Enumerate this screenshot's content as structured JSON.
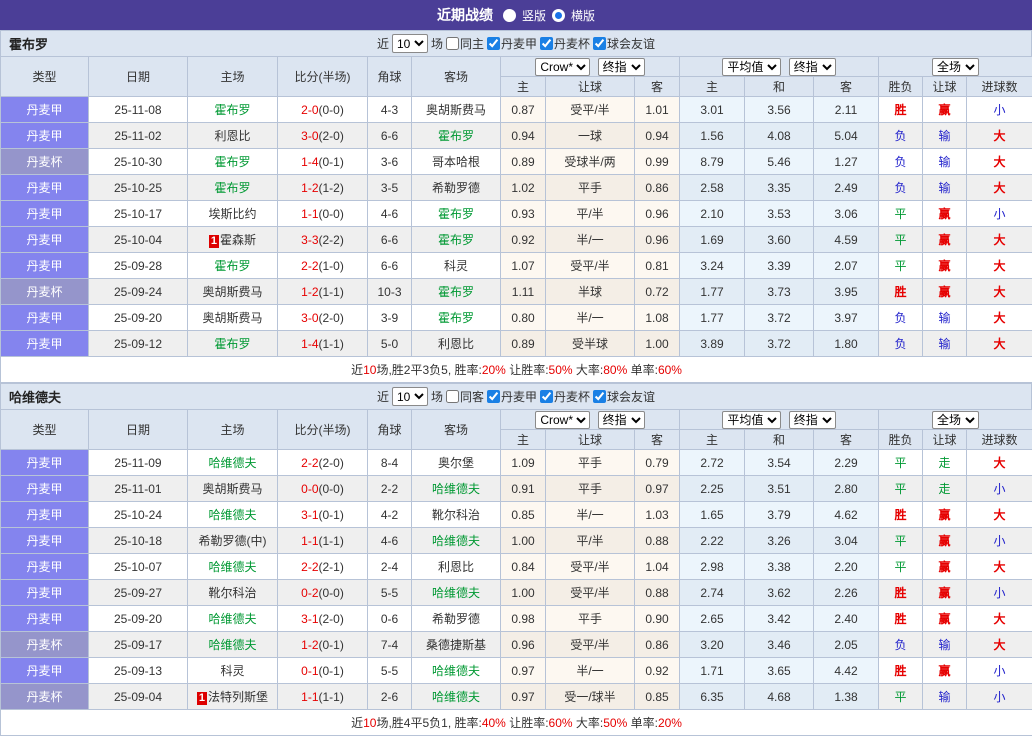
{
  "title_bar": {
    "title": "近期战绩",
    "options": [
      {
        "label": "竖版",
        "selected": false
      },
      {
        "label": "横版",
        "selected": true
      }
    ]
  },
  "palette": {
    "titlebar": "#4b3e97",
    "header_bg": "#dce5f1",
    "league_badge": "#8484ee",
    "cup_badge": "#9595cb",
    "self_team_green": "#009933",
    "win_red": "#e60000",
    "draw_green": "#009933",
    "lose_blue": "#2222cc"
  },
  "header": {
    "left": [
      "类型",
      "日期",
      "主场",
      "比分(半场)",
      "角球",
      "客场"
    ],
    "sub": [
      "主",
      "让球",
      "客",
      "主",
      "和",
      "客",
      "胜负",
      "让球",
      "进球数"
    ],
    "selects": {
      "crow": "Crow*",
      "final1": "终指",
      "average": "平均值",
      "final2": "终指",
      "full": "全场"
    }
  },
  "sections": [
    {
      "team": "霍布罗",
      "filter": {
        "near": "近",
        "count": "10",
        "unit": "场",
        "same": "同主",
        "same_checked": false,
        "leagues": [
          {
            "label": "丹麦甲",
            "checked": true
          },
          {
            "label": "丹麦杯",
            "checked": true
          },
          {
            "label": "球会友谊",
            "checked": true
          }
        ]
      },
      "rows": [
        {
          "lg": "丹麦甲",
          "cup": false,
          "date": "25-11-08",
          "home": "霍布罗",
          "hs": true,
          "hc": false,
          "score": "2-0",
          "half": "(0-0)",
          "cor": "4-3",
          "away": "奥胡斯费马",
          "as": false,
          "o": [
            "0.87",
            "受平/半",
            "1.01"
          ],
          "avg": [
            "3.01",
            "3.56",
            "2.11"
          ],
          "res": [
            [
              "胜",
              "r"
            ],
            [
              "赢",
              "r"
            ],
            [
              "小",
              "b"
            ]
          ]
        },
        {
          "lg": "丹麦甲",
          "cup": false,
          "date": "25-11-02",
          "home": "利恩比",
          "hs": false,
          "hc": false,
          "score": "3-0",
          "half": "(2-0)",
          "cor": "6-6",
          "away": "霍布罗",
          "as": true,
          "o": [
            "0.94",
            "一球",
            "0.94"
          ],
          "avg": [
            "1.56",
            "4.08",
            "5.04"
          ],
          "res": [
            [
              "负",
              "b"
            ],
            [
              "输",
              "b"
            ],
            [
              "大",
              "r"
            ]
          ]
        },
        {
          "lg": "丹麦杯",
          "cup": true,
          "date": "25-10-30",
          "home": "霍布罗",
          "hs": true,
          "hc": false,
          "score": "1-4",
          "half": "(0-1)",
          "cor": "3-6",
          "away": "哥本哈根",
          "as": false,
          "o": [
            "0.89",
            "受球半/两",
            "0.99"
          ],
          "avg": [
            "8.79",
            "5.46",
            "1.27"
          ],
          "res": [
            [
              "负",
              "b"
            ],
            [
              "输",
              "b"
            ],
            [
              "大",
              "r"
            ]
          ]
        },
        {
          "lg": "丹麦甲",
          "cup": false,
          "date": "25-10-25",
          "home": "霍布罗",
          "hs": true,
          "hc": false,
          "score": "1-2",
          "half": "(1-2)",
          "cor": "3-5",
          "away": "希勒罗德",
          "as": false,
          "o": [
            "1.02",
            "平手",
            "0.86"
          ],
          "avg": [
            "2.58",
            "3.35",
            "2.49"
          ],
          "res": [
            [
              "负",
              "b"
            ],
            [
              "输",
              "b"
            ],
            [
              "大",
              "r"
            ]
          ]
        },
        {
          "lg": "丹麦甲",
          "cup": false,
          "date": "25-10-17",
          "home": "埃斯比约",
          "hs": false,
          "hc": false,
          "score": "1-1",
          "half": "(0-0)",
          "cor": "4-6",
          "away": "霍布罗",
          "as": true,
          "o": [
            "0.93",
            "平/半",
            "0.96"
          ],
          "avg": [
            "2.10",
            "3.53",
            "3.06"
          ],
          "res": [
            [
              "平",
              "g"
            ],
            [
              "赢",
              "r"
            ],
            [
              "小",
              "b"
            ]
          ]
        },
        {
          "lg": "丹麦甲",
          "cup": false,
          "date": "25-10-04",
          "home": "霍森斯",
          "hs": false,
          "hc": true,
          "score": "3-3",
          "half": "(2-2)",
          "cor": "6-6",
          "away": "霍布罗",
          "as": true,
          "o": [
            "0.92",
            "半/一",
            "0.96"
          ],
          "avg": [
            "1.69",
            "3.60",
            "4.59"
          ],
          "res": [
            [
              "平",
              "g"
            ],
            [
              "赢",
              "r"
            ],
            [
              "大",
              "r"
            ]
          ]
        },
        {
          "lg": "丹麦甲",
          "cup": false,
          "date": "25-09-28",
          "home": "霍布罗",
          "hs": true,
          "hc": false,
          "score": "2-2",
          "half": "(1-0)",
          "cor": "6-6",
          "away": "科灵",
          "as": false,
          "o": [
            "1.07",
            "受平/半",
            "0.81"
          ],
          "avg": [
            "3.24",
            "3.39",
            "2.07"
          ],
          "res": [
            [
              "平",
              "g"
            ],
            [
              "赢",
              "r"
            ],
            [
              "大",
              "r"
            ]
          ]
        },
        {
          "lg": "丹麦杯",
          "cup": true,
          "date": "25-09-24",
          "home": "奥胡斯费马",
          "hs": false,
          "hc": false,
          "score": "1-2",
          "half": "(1-1)",
          "cor": "10-3",
          "away": "霍布罗",
          "as": true,
          "o": [
            "1.11",
            "半球",
            "0.72"
          ],
          "avg": [
            "1.77",
            "3.73",
            "3.95"
          ],
          "res": [
            [
              "胜",
              "r"
            ],
            [
              "赢",
              "r"
            ],
            [
              "大",
              "r"
            ]
          ]
        },
        {
          "lg": "丹麦甲",
          "cup": false,
          "date": "25-09-20",
          "home": "奥胡斯费马",
          "hs": false,
          "hc": false,
          "score": "3-0",
          "half": "(2-0)",
          "cor": "3-9",
          "away": "霍布罗",
          "as": true,
          "o": [
            "0.80",
            "半/一",
            "1.08"
          ],
          "avg": [
            "1.77",
            "3.72",
            "3.97"
          ],
          "res": [
            [
              "负",
              "b"
            ],
            [
              "输",
              "b"
            ],
            [
              "大",
              "r"
            ]
          ]
        },
        {
          "lg": "丹麦甲",
          "cup": false,
          "date": "25-09-12",
          "home": "霍布罗",
          "hs": true,
          "hc": false,
          "score": "1-4",
          "half": "(1-1)",
          "cor": "5-0",
          "away": "利恩比",
          "as": false,
          "o": [
            "0.89",
            "受半球",
            "1.00"
          ],
          "avg": [
            "3.89",
            "3.72",
            "1.80"
          ],
          "res": [
            [
              "负",
              "b"
            ],
            [
              "输",
              "b"
            ],
            [
              "大",
              "r"
            ]
          ]
        }
      ],
      "summary": [
        {
          "t": "近"
        },
        {
          "t": "10",
          "hl": true
        },
        {
          "t": "场,胜2平3负5, 胜率:"
        },
        {
          "t": "20%",
          "hl": true
        },
        {
          "t": " 让胜率:"
        },
        {
          "t": "50%",
          "hl": true
        },
        {
          "t": " 大率:"
        },
        {
          "t": "80%",
          "hl": true
        },
        {
          "t": " 单率:"
        },
        {
          "t": "60%",
          "hl": true
        }
      ]
    },
    {
      "team": "哈维德夫",
      "filter": {
        "near": "近",
        "count": "10",
        "unit": "场",
        "same": "同客",
        "same_checked": false,
        "leagues": [
          {
            "label": "丹麦甲",
            "checked": true
          },
          {
            "label": "丹麦杯",
            "checked": true
          },
          {
            "label": "球会友谊",
            "checked": true
          }
        ]
      },
      "rows": [
        {
          "lg": "丹麦甲",
          "cup": false,
          "date": "25-11-09",
          "home": "哈维德夫",
          "hs": true,
          "hc": false,
          "score": "2-2",
          "half": "(2-0)",
          "cor": "8-4",
          "away": "奥尔堡",
          "as": false,
          "o": [
            "1.09",
            "平手",
            "0.79"
          ],
          "avg": [
            "2.72",
            "3.54",
            "2.29"
          ],
          "res": [
            [
              "平",
              "g"
            ],
            [
              "走",
              "g"
            ],
            [
              "大",
              "r"
            ]
          ]
        },
        {
          "lg": "丹麦甲",
          "cup": false,
          "date": "25-11-01",
          "home": "奥胡斯费马",
          "hs": false,
          "hc": false,
          "score": "0-0",
          "half": "(0-0)",
          "cor": "2-2",
          "away": "哈维德夫",
          "as": true,
          "o": [
            "0.91",
            "平手",
            "0.97"
          ],
          "avg": [
            "2.25",
            "3.51",
            "2.80"
          ],
          "res": [
            [
              "平",
              "g"
            ],
            [
              "走",
              "g"
            ],
            [
              "小",
              "b"
            ]
          ]
        },
        {
          "lg": "丹麦甲",
          "cup": false,
          "date": "25-10-24",
          "home": "哈维德夫",
          "hs": true,
          "hc": false,
          "score": "3-1",
          "half": "(0-1)",
          "cor": "4-2",
          "away": "靴尔科治",
          "as": false,
          "o": [
            "0.85",
            "半/一",
            "1.03"
          ],
          "avg": [
            "1.65",
            "3.79",
            "4.62"
          ],
          "res": [
            [
              "胜",
              "r"
            ],
            [
              "赢",
              "r"
            ],
            [
              "大",
              "r"
            ]
          ]
        },
        {
          "lg": "丹麦甲",
          "cup": false,
          "date": "25-10-18",
          "home": "希勒罗德(中)",
          "hs": false,
          "hc": false,
          "score": "1-1",
          "half": "(1-1)",
          "cor": "4-6",
          "away": "哈维德夫",
          "as": true,
          "o": [
            "1.00",
            "平/半",
            "0.88"
          ],
          "avg": [
            "2.22",
            "3.26",
            "3.04"
          ],
          "res": [
            [
              "平",
              "g"
            ],
            [
              "赢",
              "r"
            ],
            [
              "小",
              "b"
            ]
          ]
        },
        {
          "lg": "丹麦甲",
          "cup": false,
          "date": "25-10-07",
          "home": "哈维德夫",
          "hs": true,
          "hc": false,
          "score": "2-2",
          "half": "(2-1)",
          "cor": "2-4",
          "away": "利恩比",
          "as": false,
          "o": [
            "0.84",
            "受平/半",
            "1.04"
          ],
          "avg": [
            "2.98",
            "3.38",
            "2.20"
          ],
          "res": [
            [
              "平",
              "g"
            ],
            [
              "赢",
              "r"
            ],
            [
              "大",
              "r"
            ]
          ]
        },
        {
          "lg": "丹麦甲",
          "cup": false,
          "date": "25-09-27",
          "home": "靴尔科治",
          "hs": false,
          "hc": false,
          "score": "0-2",
          "half": "(0-0)",
          "cor": "5-5",
          "away": "哈维德夫",
          "as": true,
          "o": [
            "1.00",
            "受平/半",
            "0.88"
          ],
          "avg": [
            "2.74",
            "3.62",
            "2.26"
          ],
          "res": [
            [
              "胜",
              "r"
            ],
            [
              "赢",
              "r"
            ],
            [
              "小",
              "b"
            ]
          ]
        },
        {
          "lg": "丹麦甲",
          "cup": false,
          "date": "25-09-20",
          "home": "哈维德夫",
          "hs": true,
          "hc": false,
          "score": "3-1",
          "half": "(2-0)",
          "cor": "0-6",
          "away": "希勒罗德",
          "as": false,
          "o": [
            "0.98",
            "平手",
            "0.90"
          ],
          "avg": [
            "2.65",
            "3.42",
            "2.40"
          ],
          "res": [
            [
              "胜",
              "r"
            ],
            [
              "赢",
              "r"
            ],
            [
              "大",
              "r"
            ]
          ]
        },
        {
          "lg": "丹麦杯",
          "cup": true,
          "date": "25-09-17",
          "home": "哈维德夫",
          "hs": true,
          "hc": false,
          "score": "1-2",
          "half": "(0-1)",
          "cor": "7-4",
          "away": "桑德捷斯基",
          "as": false,
          "o": [
            "0.96",
            "受平/半",
            "0.86"
          ],
          "avg": [
            "3.20",
            "3.46",
            "2.05"
          ],
          "res": [
            [
              "负",
              "b"
            ],
            [
              "输",
              "b"
            ],
            [
              "大",
              "r"
            ]
          ]
        },
        {
          "lg": "丹麦甲",
          "cup": false,
          "date": "25-09-13",
          "home": "科灵",
          "hs": false,
          "hc": false,
          "score": "0-1",
          "half": "(0-1)",
          "cor": "5-5",
          "away": "哈维德夫",
          "as": true,
          "o": [
            "0.97",
            "半/一",
            "0.92"
          ],
          "avg": [
            "1.71",
            "3.65",
            "4.42"
          ],
          "res": [
            [
              "胜",
              "r"
            ],
            [
              "赢",
              "r"
            ],
            [
              "小",
              "b"
            ]
          ]
        },
        {
          "lg": "丹麦杯",
          "cup": true,
          "date": "25-09-04",
          "home": "法特列斯堡",
          "hs": false,
          "hc": true,
          "score": "1-1",
          "half": "(1-1)",
          "cor": "2-6",
          "away": "哈维德夫",
          "as": true,
          "o": [
            "0.97",
            "受一/球半",
            "0.85"
          ],
          "avg": [
            "6.35",
            "4.68",
            "1.38"
          ],
          "res": [
            [
              "平",
              "g"
            ],
            [
              "输",
              "b"
            ],
            [
              "小",
              "b"
            ]
          ]
        }
      ],
      "summary": [
        {
          "t": "近"
        },
        {
          "t": "10",
          "hl": true
        },
        {
          "t": "场,胜4平5负1, 胜率:"
        },
        {
          "t": "40%",
          "hl": true
        },
        {
          "t": " 让胜率:"
        },
        {
          "t": "60%",
          "hl": true
        },
        {
          "t": " 大率:"
        },
        {
          "t": "50%",
          "hl": true
        },
        {
          "t": " 单率:"
        },
        {
          "t": "20%",
          "hl": true
        }
      ]
    }
  ]
}
